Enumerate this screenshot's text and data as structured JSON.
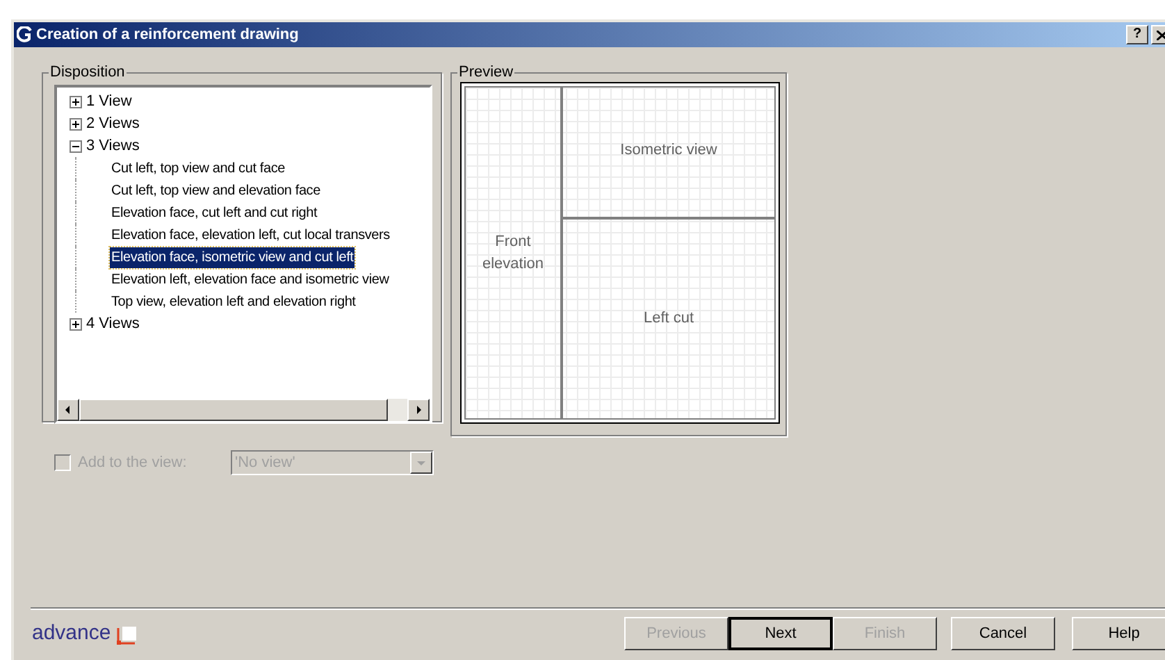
{
  "window": {
    "title": "Creation of a reinforcement drawing",
    "help_button": "?"
  },
  "disposition": {
    "label": "Disposition",
    "tree": [
      {
        "label": "1 View",
        "expanded": false
      },
      {
        "label": "2 Views",
        "expanded": false
      },
      {
        "label": "3 Views",
        "expanded": true,
        "children": [
          {
            "label": "Cut left, top view and cut face",
            "selected": false
          },
          {
            "label": "Cut left, top view and elevation face",
            "selected": false
          },
          {
            "label": "Elevation face, cut left and cut right",
            "selected": false
          },
          {
            "label": "Elevation face, elevation left, cut local transvers",
            "selected": false
          },
          {
            "label": "Elevation face, isometric view and cut left",
            "selected": true
          },
          {
            "label": "Elevation left, elevation face and isometric view",
            "selected": false
          },
          {
            "label": "Top view, elevation left and elevation right",
            "selected": false
          }
        ]
      },
      {
        "label": "4 Views",
        "expanded": false
      }
    ]
  },
  "preview": {
    "label": "Preview",
    "panes": [
      "Front elevation",
      "Isometric view",
      "Left cut"
    ]
  },
  "add_to_view": {
    "label": "Add to the view:",
    "checked": false,
    "disabled": true,
    "value": "'No view'"
  },
  "logo": "advance",
  "buttons": [
    {
      "label": "Previous",
      "disabled": true,
      "default": false
    },
    {
      "label": "Next",
      "disabled": false,
      "default": true
    },
    {
      "label": "Finish",
      "disabled": true,
      "default": false
    },
    {
      "label": "Cancel",
      "disabled": false,
      "default": false
    },
    {
      "label": "Help",
      "disabled": false,
      "default": false
    }
  ]
}
